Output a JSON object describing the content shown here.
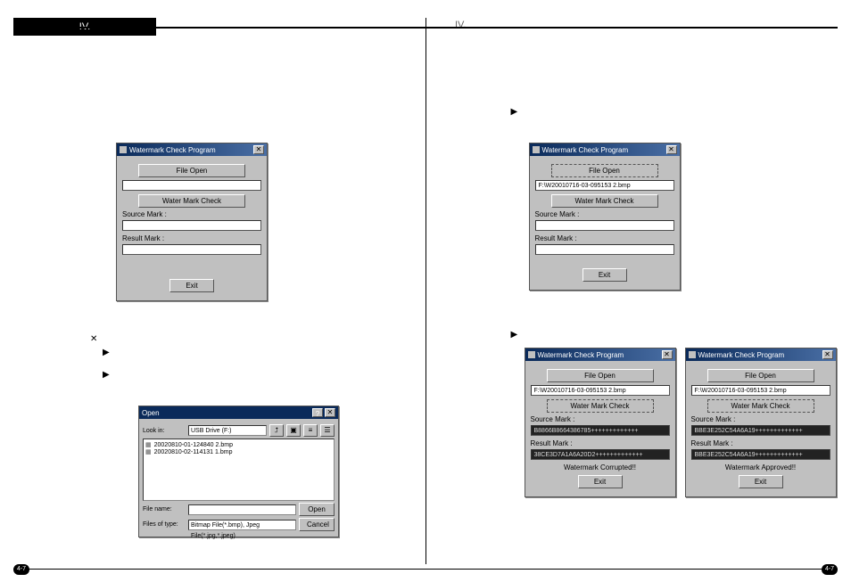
{
  "header": {
    "section_left": "IV.",
    "section_right": "IV."
  },
  "footer": {
    "page_left": "4-7",
    "page_right": "4-7"
  },
  "bullets": {
    "b1": "▶",
    "b2": "▶",
    "b3": "▶",
    "b4": "▶",
    "bx": "✕"
  },
  "wm": {
    "title": "Watermark Check Program",
    "file_open": "File Open",
    "watermark_check": "Water Mark Check",
    "source_label": "Source Mark :",
    "result_label": "Result Mark :",
    "exit": "Exit",
    "close": "✕"
  },
  "wmB_path": "F:\\W20010716-03-095153 2.bmp",
  "wmC": {
    "path": "F:\\W20010716-03-095153 2.bmp",
    "source": "B8866B8664386785+++++++++++++",
    "result": "38CE3D7A1A6A20D2+++++++++++++",
    "status": "Watermark Corrupted!!"
  },
  "wmD": {
    "path": "F:\\W20010716-03-095153 2.bmp",
    "source": "BBE3E252C54A6A19+++++++++++++",
    "result": "BBE3E252C54A6A19+++++++++++++",
    "status": "Watermark Approved!!"
  },
  "openDlg": {
    "title": "Open",
    "lookin_label": "Look in:",
    "lookin_value": "USB Drive (F:)",
    "files": [
      "20020810-01-124840 2.bmp",
      "20020810-02-114131 1.bmp"
    ],
    "filename_label": "File name:",
    "filename_value": "",
    "filetype_label": "Files of type:",
    "filetype_value": "Bitmap File(*.bmp), Jpeg File(*.jpg,*.jpeg)",
    "open_btn": "Open",
    "cancel_btn": "Cancel",
    "close": "✕"
  }
}
